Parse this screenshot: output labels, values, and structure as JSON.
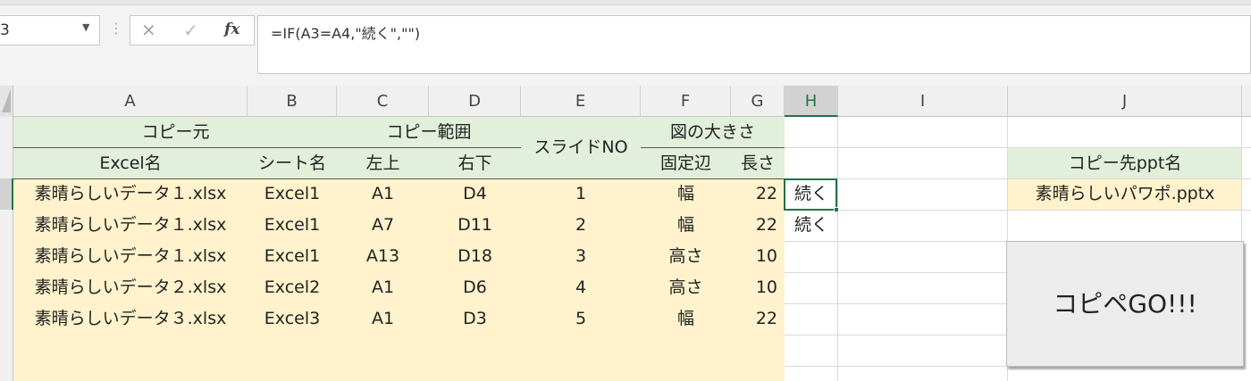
{
  "formula_bar": {
    "name_box": "3",
    "cancel_icon": "✕",
    "enter_icon": "✓",
    "fx_label": "fx",
    "formula": "=IF(A3=A4,\"続く\",\"\")"
  },
  "columns": [
    "A",
    "B",
    "C",
    "D",
    "E",
    "F",
    "G",
    "H",
    "I",
    "J"
  ],
  "selected_column": "H",
  "headers": {
    "copy_source": "コピー元",
    "copy_range": "コピー範囲",
    "slide_no": "スライドNO",
    "figure_size": "図の大きさ",
    "excel_name": "Excel名",
    "sheet_name": "シート名",
    "top_left": "左上",
    "bottom_right": "右下",
    "fixed_side": "固定辺",
    "length": "長さ",
    "dest_ppt_name": "コピー先ppt名"
  },
  "rows": [
    {
      "excel": "素晴らしいデータ１.xlsx",
      "sheet": "Excel1",
      "tl": "A1",
      "br": "D4",
      "slide": "1",
      "side": "幅",
      "len": "22",
      "h": "続く"
    },
    {
      "excel": "素晴らしいデータ１.xlsx",
      "sheet": "Excel1",
      "tl": "A7",
      "br": "D11",
      "slide": "2",
      "side": "幅",
      "len": "22",
      "h": "続く"
    },
    {
      "excel": "素晴らしいデータ１.xlsx",
      "sheet": "Excel1",
      "tl": "A13",
      "br": "D18",
      "slide": "3",
      "side": "高さ",
      "len": "10",
      "h": ""
    },
    {
      "excel": "素晴らしいデータ２.xlsx",
      "sheet": "Excel2",
      "tl": "A1",
      "br": "D6",
      "slide": "4",
      "side": "高さ",
      "len": "10",
      "h": ""
    },
    {
      "excel": "素晴らしいデータ３.xlsx",
      "sheet": "Excel3",
      "tl": "A1",
      "br": "D3",
      "slide": "5",
      "side": "幅",
      "len": "22",
      "h": ""
    }
  ],
  "dest_ppt_value": "素晴らしいパワポ.pptx",
  "go_button": "コピペGO!!!"
}
